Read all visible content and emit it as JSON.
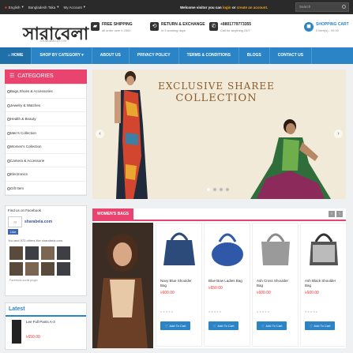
{
  "topbar": {
    "language": "English",
    "currency": "Bangladesh Taka",
    "account": "My Account",
    "welcome_pre": "Welcome visitor you can ",
    "login": "login",
    "welcome_mid": " or ",
    "create": "create an account.",
    "search_placeholder": "Search"
  },
  "header": {
    "logo": "সারাবেলা",
    "logo_sub": "SHARABELA.COM",
    "features": [
      {
        "title": "FREE SHIPPING",
        "sub": "all order over ৳ 2500",
        "icon": "truck-icon"
      },
      {
        "title": "RETURN & EXCHANGE",
        "sub": "in 3 working days",
        "icon": "return-icon"
      },
      {
        "title": "+8801779773355",
        "sub": "Call for anything 24/7",
        "icon": "phone-icon"
      }
    ],
    "cart_title": "SHOPPING CART",
    "cart_sub": "0 item(s) - ৳0.00"
  },
  "nav": [
    "HOME",
    "SHOP BY CATEGORY",
    "ABOUT US",
    "PRIVACY POLICY",
    "TERMS & CONDITIONS",
    "BLOGS",
    "CONTACT US"
  ],
  "categories": {
    "title": "CATEGORIES",
    "items": [
      "Bags,Shoes & Accessories",
      "Jewelry & Watches",
      "Health & Beauty",
      "Men's Collection",
      "Women's Collection",
      "Camera & Accessorie",
      "Electronics",
      "Gift Item"
    ]
  },
  "facebook": {
    "heading": "Find us on Facebook",
    "page_name": "sharabela.com",
    "like_text": "Like",
    "likes": "You and 572 others like sharabela.com.",
    "plugin": "Facebook social plugin"
  },
  "latest": {
    "title": "Latest",
    "item_name": "Lee Full Pants A-3",
    "item_price": "৳650.00"
  },
  "slider": {
    "title_line1": "EXCLUSIVE SHAREE",
    "title_line2": "COLLECTION"
  },
  "womens_bags": {
    "title": "WOMEN'S BAGS",
    "add_label": "Add To Cart",
    "products": [
      {
        "name": "Navy Blue Shoulder Bag",
        "price": "৳600.00",
        "color": "#2c4a7a"
      },
      {
        "name": "Blue Bow Ladies Bag",
        "price": "৳650.00",
        "color": "#2f58a8"
      },
      {
        "name": "Ash Cross Shoulder Bag",
        "price": "৳600.00",
        "color": "#9a9a9a"
      },
      {
        "name": "Ash Black Shoulder Bag",
        "price": "৳600.00",
        "color": "#555555"
      }
    ]
  },
  "colors": {
    "accent": "#2a84c6",
    "pink": "#e8446f",
    "price": "#e33333"
  }
}
